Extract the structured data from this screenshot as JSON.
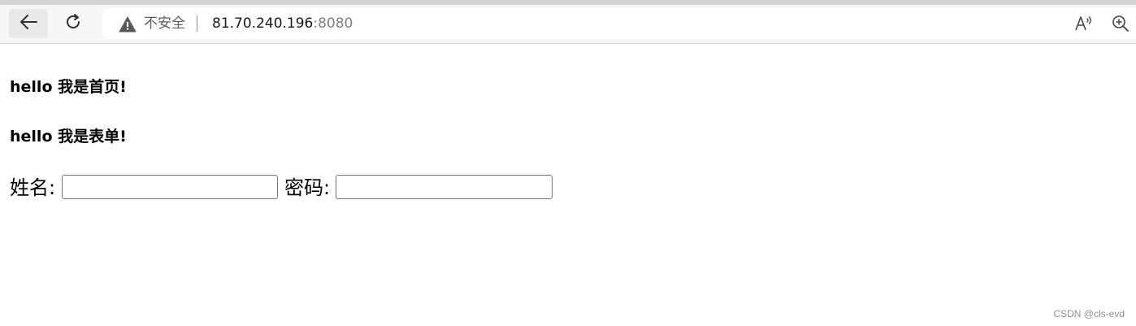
{
  "browser": {
    "security_label": "不安全",
    "url_host": "81.70.240.196",
    "url_port": ":8080",
    "icons": {
      "back": "arrow-left-icon",
      "reload": "reload-icon",
      "warning": "warning-triangle-icon",
      "read_aloud": "read-aloud-icon",
      "zoom": "zoom-in-icon"
    }
  },
  "page": {
    "heading_home": "hello 我是首页!",
    "heading_form": "hello 我是表单!",
    "form": {
      "name_label": "姓名:",
      "name_value": "",
      "password_label": "密码:",
      "password_value": ""
    }
  },
  "watermark": "CSDN @cls-evd"
}
